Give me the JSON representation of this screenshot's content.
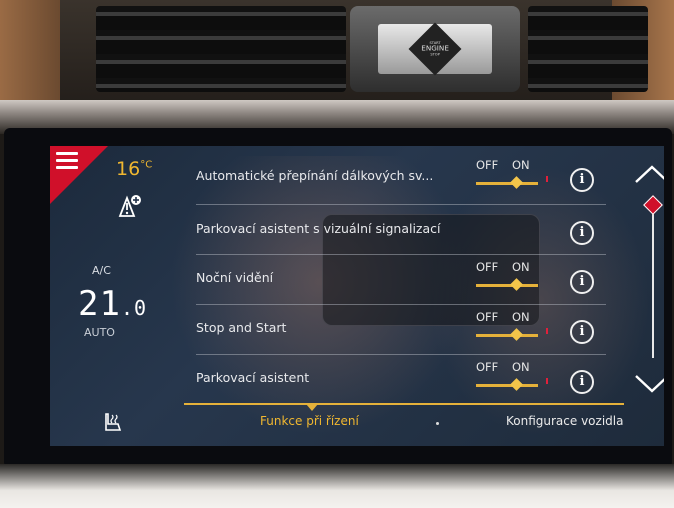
{
  "start_button": {
    "line1": "START",
    "line2": "ENGINE",
    "line3": "STOP"
  },
  "climate": {
    "outside_temp": "16",
    "temp_unit": "°C",
    "ac_label": "A/C",
    "set_temp_int": "21",
    "set_temp_dec": ".0",
    "auto_label": "AUTO"
  },
  "settings": [
    {
      "label": "Automatické přepínání dálkových sv...",
      "has_toggle": true,
      "off": "OFF",
      "on": "ON",
      "state": "on"
    },
    {
      "label": "Parkovací asistent s vizuální signalizací",
      "has_toggle": false
    },
    {
      "label": "Noční vidění",
      "has_toggle": true,
      "off": "OFF",
      "on": "ON",
      "state": "on"
    },
    {
      "label": "Stop and Start",
      "has_toggle": true,
      "off": "OFF",
      "on": "ON",
      "state": "on"
    },
    {
      "label": "Parkovací asistent",
      "has_toggle": true,
      "off": "OFF",
      "on": "ON",
      "state": "on"
    }
  ],
  "info_glyph": "i",
  "tabs": [
    {
      "label": "Funkce při řízení",
      "active": true
    },
    {
      "label": "Konfigurace vozidla",
      "active": false
    }
  ],
  "colors": {
    "accent": "#e5b13a",
    "brand_red": "#d0102a",
    "screen_bg": "#22324a"
  }
}
